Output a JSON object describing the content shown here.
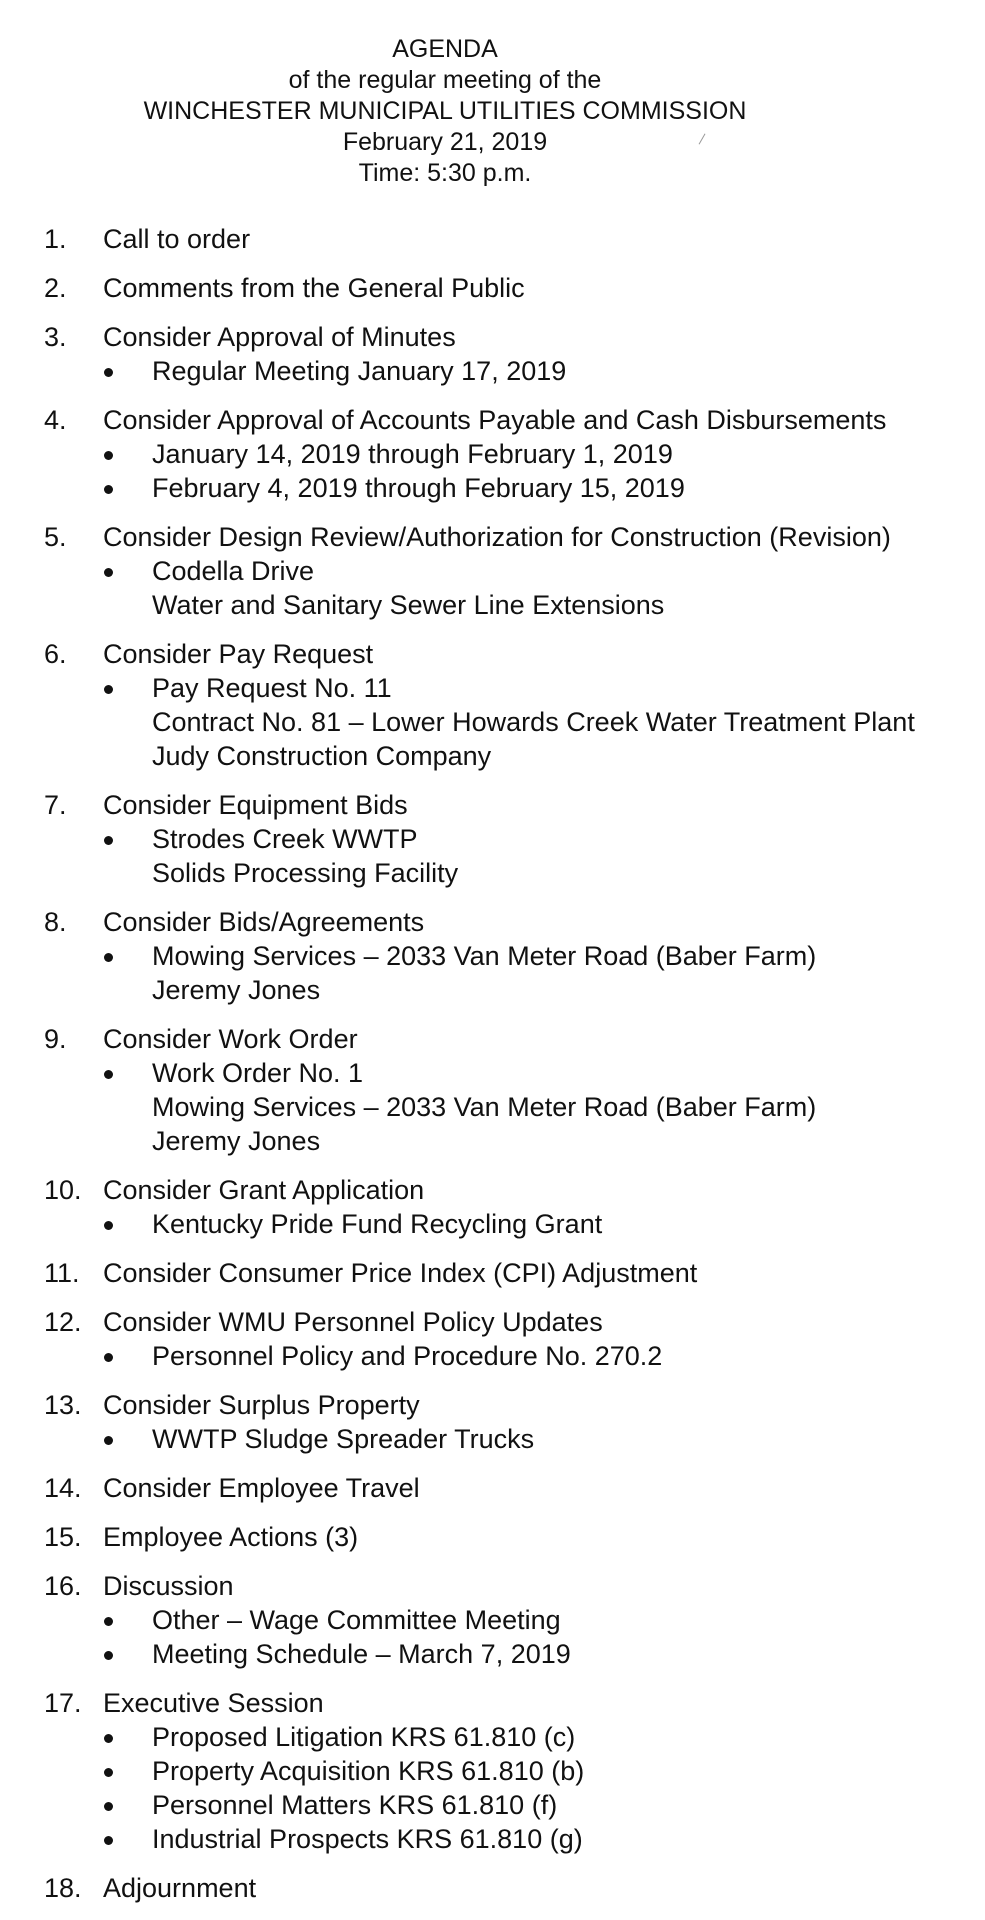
{
  "header": {
    "title": "AGENDA",
    "line2": "of the regular meeting of the",
    "line3": "WINCHESTER MUNICIPAL UTILITIES COMMISSION",
    "date": "February 21, 2019",
    "time": "Time:  5:30 p.m."
  },
  "items": [
    {
      "number": "1.",
      "title": "Call to order",
      "subs": []
    },
    {
      "number": "2.",
      "title": "Comments from the General Public",
      "subs": []
    },
    {
      "number": "3.",
      "title": "Consider Approval of Minutes",
      "subs": [
        [
          "Regular Meeting January 17, 2019"
        ]
      ]
    },
    {
      "number": "4.",
      "title": "Consider Approval of Accounts Payable and Cash Disbursements",
      "subs": [
        [
          "January 14, 2019 through February 1, 2019"
        ],
        [
          "February 4, 2019 through February 15, 2019"
        ]
      ]
    },
    {
      "number": "5.",
      "title": "Consider Design Review/Authorization for Construction (Revision)",
      "subs": [
        [
          "Codella Drive",
          "Water and Sanitary Sewer Line Extensions"
        ]
      ]
    },
    {
      "number": "6.",
      "title": "Consider Pay Request",
      "subs": [
        [
          "Pay Request No. 11",
          "Contract No. 81 – Lower Howards Creek Water Treatment Plant",
          "Judy Construction Company"
        ]
      ]
    },
    {
      "number": "7.",
      "title": "Consider Equipment Bids",
      "subs": [
        [
          "Strodes Creek WWTP",
          "Solids Processing Facility"
        ]
      ]
    },
    {
      "number": "8.",
      "title": "Consider Bids/Agreements",
      "subs": [
        [
          "Mowing Services – 2033 Van Meter Road (Baber Farm)",
          "Jeremy Jones"
        ]
      ]
    },
    {
      "number": "9.",
      "title": "Consider Work Order",
      "subs": [
        [
          "Work Order No. 1",
          "Mowing Services – 2033 Van Meter Road (Baber Farm)",
          "Jeremy Jones"
        ]
      ]
    },
    {
      "number": "10.",
      "title": "Consider Grant Application",
      "subs": [
        [
          "Kentucky Pride Fund Recycling Grant"
        ]
      ]
    },
    {
      "number": "11.",
      "title": "Consider Consumer Price Index (CPI) Adjustment",
      "subs": []
    },
    {
      "number": "12.",
      "title": "Consider WMU Personnel Policy Updates",
      "subs": [
        [
          "Personnel Policy and Procedure No. 270.2"
        ]
      ]
    },
    {
      "number": "13.",
      "title": "Consider Surplus Property",
      "subs": [
        [
          "WWTP Sludge Spreader Trucks"
        ]
      ]
    },
    {
      "number": "14.",
      "title": "Consider Employee Travel",
      "subs": []
    },
    {
      "number": "15.",
      "title": "Employee Actions (3)",
      "subs": []
    },
    {
      "number": "16.",
      "title": "Discussion",
      "subs": [
        [
          "Other – Wage Committee Meeting"
        ],
        [
          "Meeting Schedule – March 7, 2019"
        ]
      ]
    },
    {
      "number": "17.",
      "title": "Executive Session",
      "subs": [
        [
          "Proposed Litigation KRS 61.810 (c)"
        ],
        [
          "Property Acquisition KRS 61.810 (b)"
        ],
        [
          "Personnel Matters KRS 61.810 (f)"
        ],
        [
          "Industrial Prospects KRS 61.810 (g)"
        ]
      ]
    },
    {
      "number": "18.",
      "title": "Adjournment",
      "subs": []
    }
  ]
}
